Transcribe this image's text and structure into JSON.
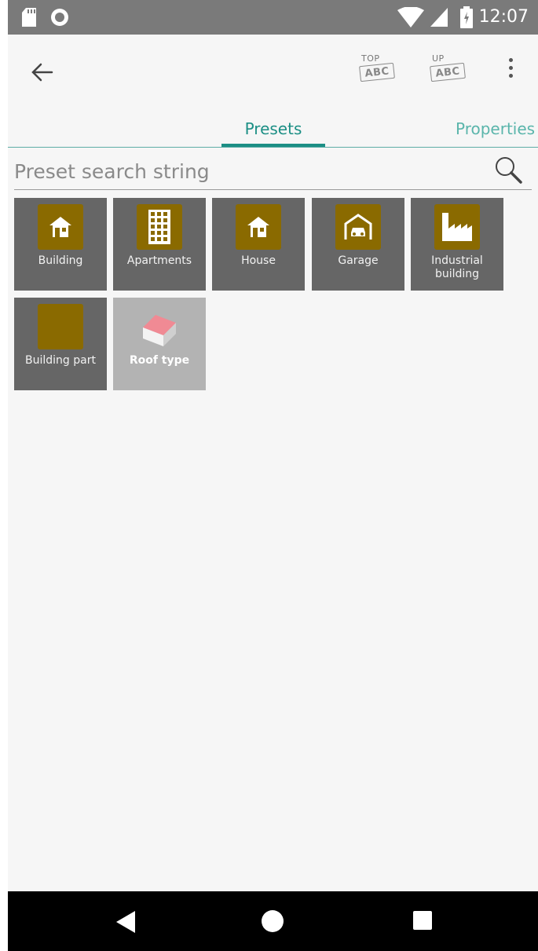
{
  "status_bar": {
    "time": "12:07"
  },
  "toolbar": {
    "top_button": {
      "small": "TOP",
      "box": "ABC"
    },
    "up_button": {
      "small": "UP",
      "box": "ABC"
    }
  },
  "tabs": [
    {
      "label": "Presets",
      "selected": true
    },
    {
      "label": "Properties",
      "selected": false
    }
  ],
  "search": {
    "placeholder": "Preset search string",
    "value": ""
  },
  "presets": [
    {
      "label": "Building",
      "icon": "house-icon"
    },
    {
      "label": "Apartments",
      "icon": "apartments-icon"
    },
    {
      "label": "House",
      "icon": "house-icon"
    },
    {
      "label": "Garage",
      "icon": "garage-icon"
    },
    {
      "label": "Industrial building",
      "icon": "factory-icon"
    },
    {
      "label": "Building part",
      "icon": "blank-icon"
    },
    {
      "label": "Roof type",
      "icon": "roof-icon"
    }
  ],
  "colors": {
    "accent": "#1c8f85",
    "tile_bg": "#666666",
    "tile_icon_bg": "#8a6a00",
    "tile_light_bg": "#b3b3b3",
    "status_bar": "#7a7a7a",
    "nav_bar": "#000000"
  }
}
